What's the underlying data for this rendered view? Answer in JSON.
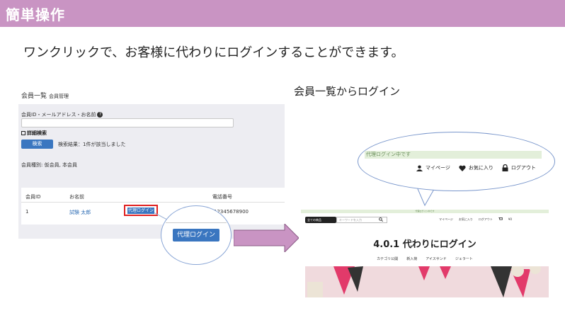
{
  "header": {
    "title": "簡単操作"
  },
  "subtitle": "ワンクリックで、お客様に代わりにログインすることができます。",
  "admin": {
    "title": "会員一覧",
    "title_small": "会員管理",
    "field_label": "会員ID・メールアドレス・お名前",
    "detail_toggle": "詳細検索",
    "search_button": "検索",
    "result_text": "検索結果：1件が該当しました",
    "member_type": "会員種別: 仮会員, 本会員",
    "columns": [
      "会員ID",
      "お名前",
      "電話番号"
    ],
    "row": {
      "id": "1",
      "name": "試験 太郎",
      "phone": "12345678900"
    },
    "proxy_small": "代理ログイン",
    "proxy_zoom": "代理ログイン"
  },
  "right": {
    "title": "会員一覧からログイン",
    "banner": "代理ログイン中です",
    "nav": {
      "mypage": "マイページ",
      "favorites": "お気に入り",
      "logout": "ログアウト"
    }
  },
  "site": {
    "banner": "代理ログイン中です",
    "category": "全ての商品",
    "search_placeholder": "キーワードを入力",
    "nav": [
      "マイページ",
      "お気に入り",
      "ログアウト",
      "¥0"
    ],
    "heading": "4.0.1 代わりにログイン",
    "menu": [
      "カテゴリ公開",
      "新入荷",
      "アイスサンド",
      "ジェラート"
    ]
  },
  "colors": {
    "header": "#c994c3",
    "primary_button": "#3a76c0",
    "highlight": "#e02020",
    "banner": "#e3efda"
  },
  "icons": [
    "help-icon",
    "user-icon",
    "heart-icon",
    "lock-icon",
    "cart-icon",
    "search-icon",
    "arrow-right-icon"
  ]
}
